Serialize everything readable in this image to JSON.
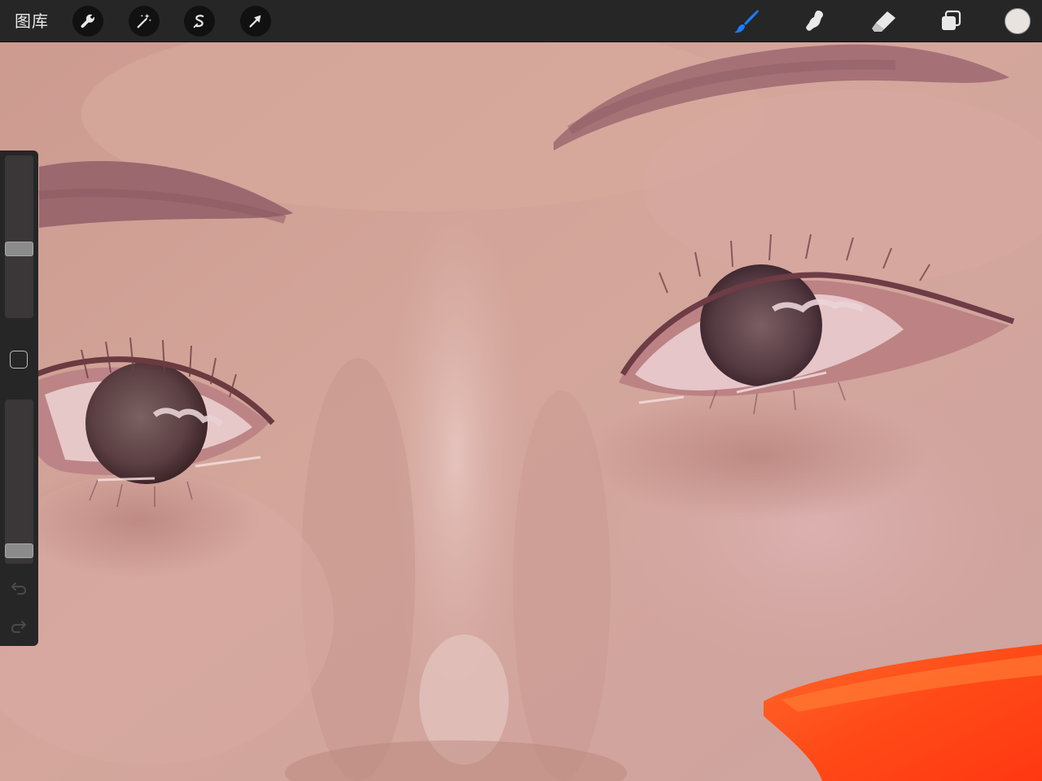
{
  "toolbar": {
    "gallery_label": "图库",
    "left_tools": [
      {
        "name": "actions",
        "icon": "wrench-icon"
      },
      {
        "name": "adjustments",
        "icon": "magic-wand-icon"
      },
      {
        "name": "selection",
        "icon": "selection-s-icon"
      },
      {
        "name": "transform",
        "icon": "arrow-cursor-icon"
      }
    ],
    "right_tools": [
      {
        "name": "paint",
        "icon": "brush-icon",
        "active": true
      },
      {
        "name": "smudge",
        "icon": "smudge-finger-icon",
        "active": false
      },
      {
        "name": "erase",
        "icon": "eraser-icon",
        "active": false
      },
      {
        "name": "layers",
        "icon": "layers-icon",
        "active": false
      }
    ],
    "current_color": "#e9e3df",
    "active_color": "#1a7cff"
  },
  "sidebar": {
    "brush_size_level": 0.42,
    "brush_opacity_level": 0.04,
    "modify_button_icon": "square-icon",
    "undo_icon": "undo-arrow-icon",
    "redo_icon": "redo-arrow-icon"
  },
  "canvas": {
    "subject": "painting",
    "background_color": "#c99a90",
    "accent_stroke_color": "#ff4a17"
  }
}
